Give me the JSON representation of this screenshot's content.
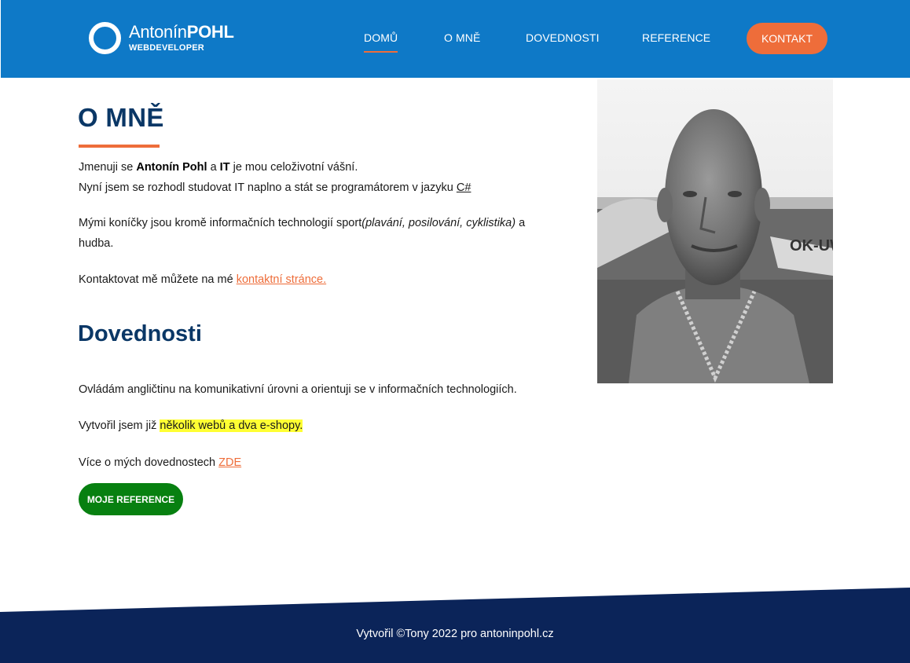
{
  "header": {
    "logo": {
      "name_light": "Antonín",
      "name_bold": "POHL",
      "subtitle": "WEBDEVELOPER"
    },
    "nav": [
      {
        "label": "DOMŮ",
        "active": true
      },
      {
        "label": "O MNĚ",
        "active": false
      },
      {
        "label": "DOVEDNOSTI",
        "active": false
      },
      {
        "label": "REFERENCE",
        "active": false
      }
    ],
    "cta_label": "KONTAKT"
  },
  "about": {
    "title": "O MNĚ",
    "line1": {
      "prefix": "Jmenuji se ",
      "name": "Antonín Pohl",
      "mid": " a ",
      "it": "IT",
      "suffix": " je mou celoživotní vášní."
    },
    "line2": {
      "text": "Nyní jsem se rozhodl studovat IT naplno a stát se programátorem v jazyku ",
      "link": "C#"
    },
    "hobbies": {
      "prefix": "Mými koníčky jsou kromě informačních technologií sport",
      "italic": "(plavání, posilování, cyklistika)",
      "suffix": " a",
      "line2": "hudba."
    },
    "contact": {
      "prefix": "Kontaktovat mě můžete na mé ",
      "link": "kontaktní stránce."
    }
  },
  "skills": {
    "title": "Dovednosti",
    "english": "Ovládám angličtinu na komunikativní úrovni a orientuji se v informačních technologiích.",
    "webs": {
      "prefix": "Vytvořil jsem již ",
      "highlight": "několik webů a dva e-shopy."
    },
    "more": {
      "prefix": "Více o mých dovednostech ",
      "link": "ZDE"
    },
    "button": "MOJE REFERENCE"
  },
  "footer": {
    "text": "Vytvořil ©Tony 2022 pro antoninpohl.cz"
  },
  "colors": {
    "header_bg": "#0e79c7",
    "accent": "#ee6d3a",
    "heading": "#0a3766",
    "button_green": "#078010",
    "footer_bg": "#0b2459",
    "highlight": "#ffff33"
  }
}
